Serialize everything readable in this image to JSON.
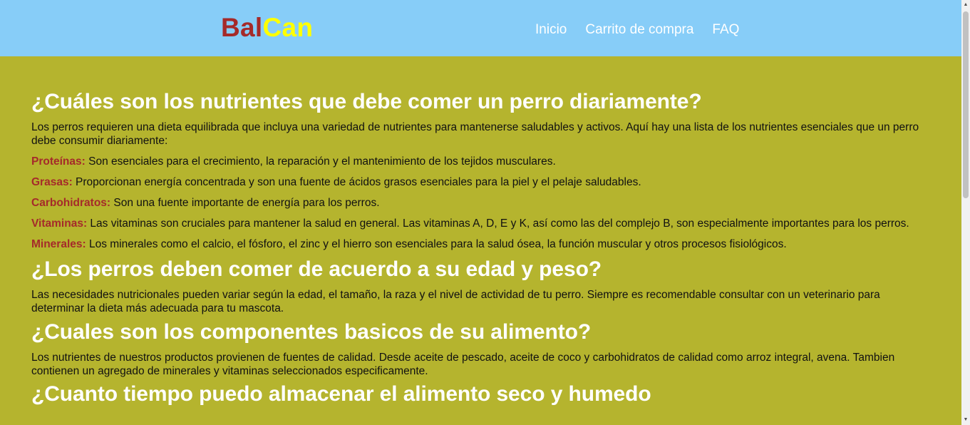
{
  "header": {
    "logo_part1": "Bal",
    "logo_part2": "Can",
    "nav": [
      "Inicio",
      "Carrito de compra",
      "FAQ"
    ]
  },
  "sections": {
    "s1": {
      "title": "¿Cuáles son los nutrientes que debe comer un perro diariamente?",
      "intro": "Los perros requieren una dieta equilibrada que incluya una variedad de nutrientes para mantenerse saludables y activos. Aquí hay una lista de los nutrientes esenciales que un perro debe consumir diariamente:",
      "items": [
        {
          "term": "Proteínas:",
          "text": " Son esenciales para el crecimiento, la reparación y el mantenimiento de los tejidos musculares."
        },
        {
          "term": "Grasas:",
          "text": " Proporcionan energía concentrada y son una fuente de ácidos grasos esenciales para la piel y el pelaje saludables."
        },
        {
          "term": "Carbohidratos:",
          "text": " Son una fuente importante de energía para los perros."
        },
        {
          "term": "Vitaminas:",
          "text": " Las vitaminas son cruciales para mantener la salud en general. Las vitaminas A, D, E y K, así como las del complejo B, son especialmente importantes para los perros."
        },
        {
          "term": "Minerales:",
          "text": " Los minerales como el calcio, el fósforo, el zinc y el hierro son esenciales para la salud ósea, la función muscular y otros procesos fisiológicos."
        }
      ]
    },
    "s2": {
      "title": "¿Los perros deben comer de acuerdo a su edad y peso?",
      "text": "Las necesidades nutricionales pueden variar según la edad, el tamaño, la raza y el nivel de actividad de tu perro. Siempre es recomendable consultar con un veterinario para determinar la dieta más adecuada para tu mascota."
    },
    "s3": {
      "title": "¿Cuales son los componentes basicos de su alimento?",
      "text": "Los nutrientes de nuestros productos provienen de fuentes de calidad. Desde aceite de pescado, aceite de coco y carbohidratos de calidad como arroz integral, avena. Tambien contienen un agregado de minerales y vitaminas seleccionados especificamente."
    },
    "s4": {
      "title": "¿Cuanto tiempo puedo almacenar el alimento seco y humedo"
    }
  },
  "colors": {
    "header_bg": "#87cdf8",
    "page_bg": "#b5b42e",
    "logo_red": "#a52a2a",
    "logo_yellow": "#ffff00",
    "term_color": "#a52a2a"
  },
  "icons": {
    "scroll_up": "scroll-up-arrow-icon",
    "scroll_down": "scroll-down-arrow-icon"
  }
}
